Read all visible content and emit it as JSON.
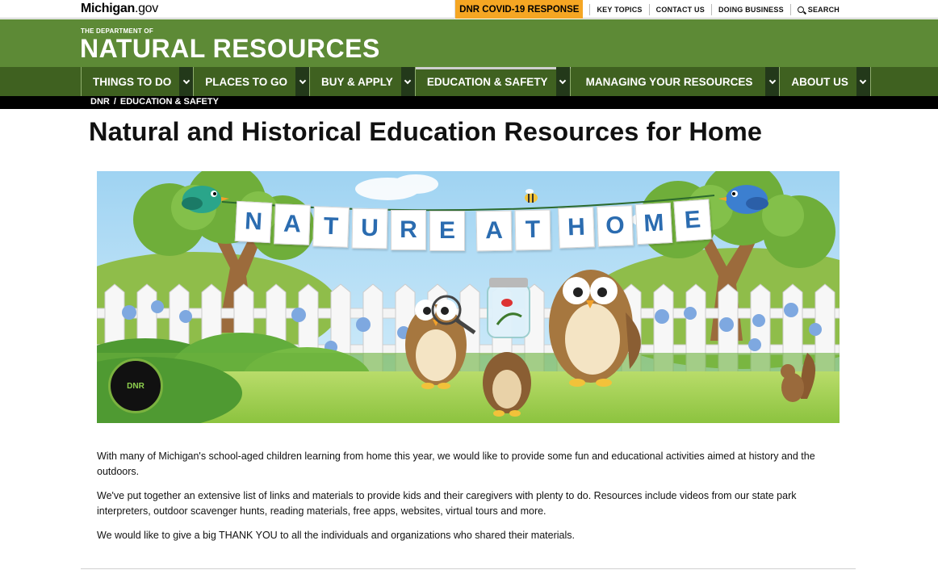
{
  "topbar": {
    "logo_bold": "Michigan",
    "logo_suffix": ".gov",
    "covid_label": "DNR COVID-19 RESPONSE",
    "links": [
      "KEY TOPICS",
      "CONTACT US",
      "DOING BUSINESS"
    ],
    "search_label": "SEARCH"
  },
  "header": {
    "dept_small": "THE DEPARTMENT OF",
    "dept_big": "NATURAL RESOURCES"
  },
  "nav": {
    "items": [
      {
        "label": "THINGS TO DO"
      },
      {
        "label": "PLACES TO GO"
      },
      {
        "label": "BUY & APPLY"
      },
      {
        "label": "EDUCATION & SAFETY"
      },
      {
        "label": "MANAGING YOUR RESOURCES"
      },
      {
        "label": "ABOUT US"
      }
    ]
  },
  "breadcrumb": {
    "items": [
      "DNR",
      "EDUCATION & SAFETY"
    ],
    "separator": "/"
  },
  "page": {
    "title": "Natural and Historical Education Resources for Home"
  },
  "banner": {
    "letters": [
      "N",
      "A",
      "T",
      "U",
      "R",
      "E",
      "A",
      "T",
      "H",
      "O",
      "M",
      "E"
    ],
    "seal_label": "DNR"
  },
  "body": {
    "paragraphs": [
      "With many of Michigan's school-aged children learning from home this year, we would like to provide some fun and educational activities aimed at history and the outdoors.",
      "We've put together an extensive list of links and materials to provide kids and their caregivers with plenty to do. Resources include videos from our state park interpreters, outdoor scavenger hunts, reading materials, free apps, websites, virtual tours and more.",
      "We would like to give a big THANK YOU to all the individuals and organizations who shared their materials."
    ]
  }
}
